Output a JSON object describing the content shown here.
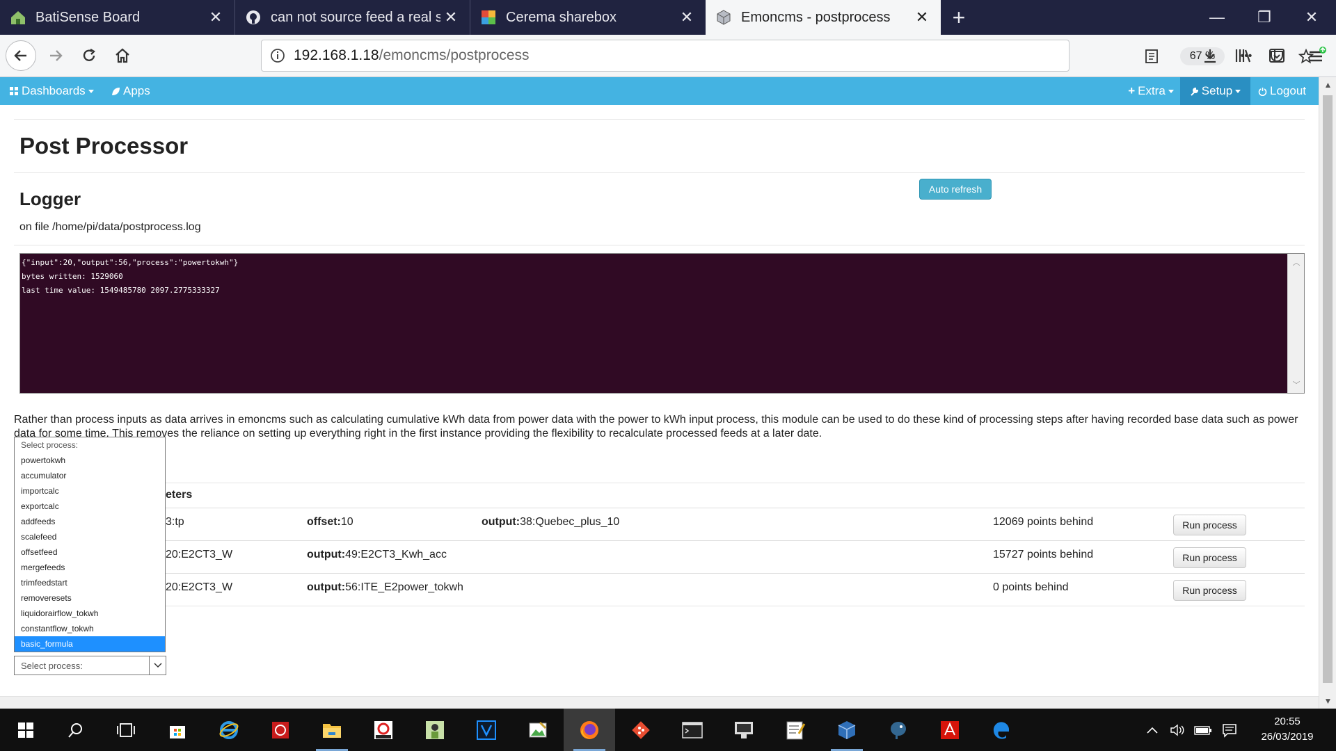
{
  "browser": {
    "tabs": [
      {
        "title": "BatiSense Board",
        "icon": "house-icon",
        "active": false
      },
      {
        "title": "can not source feed a real sens",
        "icon": "github-icon",
        "active": false
      },
      {
        "title": "Cerema sharebox",
        "icon": "sharebox-icon",
        "active": false
      },
      {
        "title": "Emoncms - postprocess",
        "icon": "cube-icon",
        "active": true
      }
    ],
    "url_host": "192.168.1.18",
    "url_path": "/emoncms/postprocess",
    "zoom": "67 %"
  },
  "nav": {
    "dashboards": "Dashboards",
    "apps": "Apps",
    "extra": "Extra",
    "setup": "Setup",
    "logout": "Logout"
  },
  "page": {
    "title": "Post Processor",
    "logger_heading": "Logger",
    "log_file": "on file /home/pi/data/postprocess.log",
    "auto_refresh": "Auto refresh",
    "log_lines": [
      "{\"input\":20,\"output\":56,\"process\":\"powertokwh\"}",
      "bytes written: 1529060",
      "last time value: 1549485780 2097.2775333327"
    ],
    "description": "Rather than process inputs as data arrives in emoncms such as calculating cumulative kWh data from power data with the power to kWh input process, this module can be used to do these kind of processing steps after having recorded base data such as power data for some time. This removes the reliance on setting up everything right in the first instance providing the flexibility to recalculate processed feeds at a later date.",
    "table_header_partial": "eters",
    "rows": [
      {
        "c1": "3:tp",
        "c2_label": "offset:",
        "c2_value": "10",
        "c3_label": "output:",
        "c3_value": "38:Quebec_plus_10",
        "status": "12069 points behind",
        "button": "Run process"
      },
      {
        "c1": "20:E2CT3_W",
        "c2_label": "output:",
        "c2_value": "49:E2CT3_Kwh_acc",
        "c3_label": "",
        "c3_value": "",
        "status": "15727 points behind",
        "button": "Run process"
      },
      {
        "c1": "20:E2CT3_W",
        "c2_label": "output:",
        "c2_value": "56:ITE_E2power_tokwh",
        "c3_label": "",
        "c3_value": "",
        "status": "0 points behind",
        "button": "Run process"
      }
    ],
    "dropdown_options": [
      "Select process:",
      "powertokwh",
      "accumulator",
      "importcalc",
      "exportcalc",
      "addfeeds",
      "scalefeed",
      "offsetfeed",
      "mergefeeds",
      "trimfeedstart",
      "removeresets",
      "liquidorairflow_tokwh",
      "constantflow_tokwh",
      "basic_formula"
    ],
    "dropdown_highlighted": "basic_formula",
    "select_value": "Select process:"
  },
  "taskbar": {
    "time": "20:55",
    "date": "26/03/2019"
  },
  "colors": {
    "emon_nav": "#44b3e2",
    "log_bg": "#300a24",
    "browser_frame": "#202340"
  }
}
